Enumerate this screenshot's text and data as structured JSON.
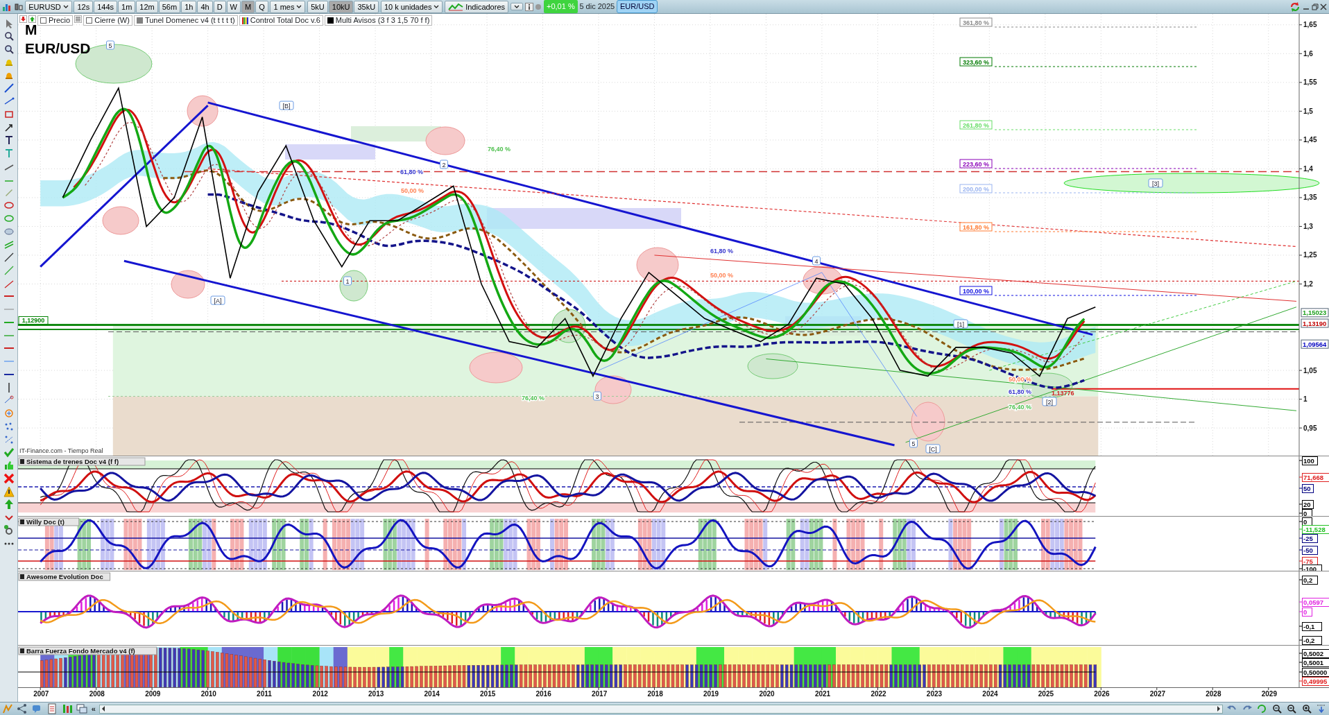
{
  "toolbar": {
    "symbol": "EURUSD",
    "timeframes": [
      {
        "label": "12s",
        "selected": false
      },
      {
        "label": "144s",
        "selected": false
      },
      {
        "label": "1m",
        "selected": false
      },
      {
        "label": "12m",
        "selected": false
      },
      {
        "label": "56m",
        "selected": false
      },
      {
        "label": "1h",
        "selected": false
      },
      {
        "label": "4h",
        "selected": false
      },
      {
        "label": "D",
        "selected": false
      },
      {
        "label": "W",
        "selected": false
      },
      {
        "label": "M",
        "selected": true
      },
      {
        "label": "Q",
        "selected": false
      }
    ],
    "period": "1 mes",
    "units": [
      {
        "label": "5kU",
        "selected": false
      },
      {
        "label": "10kU",
        "selected": true
      },
      {
        "label": "35kU",
        "selected": false
      }
    ],
    "units_dropdown": "10 k unidades",
    "indicators": "Indicadores",
    "change": "+0,01 %",
    "date": "5 dic 2025",
    "instrument": "EUR/USD"
  },
  "legend": [
    {
      "kind": "checkbox",
      "label": "Precio",
      "checked": false
    },
    {
      "kind": "checkbox",
      "label": "Cierre (W)",
      "checked": false
    },
    {
      "kind": "swatch",
      "label": "Tunel Domenec v4 (t t t t t)",
      "color": "#808080"
    },
    {
      "kind": "bars",
      "label": "Control Total Doc v.6"
    },
    {
      "kind": "swatch",
      "label": "Multi Avisos (3 f 3 1,5 70 f f)",
      "color": "#000000"
    }
  ],
  "main_chart": {
    "timeframe_label": "M",
    "source": "IT-Finance.com - Tiempo Real",
    "symbol_label": "EUR/USD",
    "price_axis": [
      "1,65",
      "1,6",
      "1,55",
      "1,5",
      "1,45",
      "1,4",
      "1,35",
      "1,3",
      "1,25",
      "1,2",
      "1,05",
      "1",
      "0,95"
    ],
    "price_tags": [
      {
        "text": "1,15023",
        "color": "#1a9e1a"
      },
      {
        "text": "1,13190",
        "color": "#c00000"
      },
      {
        "text": "1,09564",
        "color": "#0000c0"
      }
    ],
    "line_tag": {
      "text": "1,12900",
      "color": "#008000"
    },
    "fib_labels": [
      {
        "kind": "box",
        "text": "361,80 %",
        "color": "#8a8a8a"
      },
      {
        "kind": "box",
        "text": "323,60 %",
        "color": "#007a00"
      },
      {
        "kind": "box",
        "text": "261,80 %",
        "color": "#66dd66"
      },
      {
        "kind": "box",
        "text": "223,60 %",
        "color": "#8a00b8"
      },
      {
        "kind": "box",
        "text": "200,00 %",
        "color": "#9ab4f0"
      },
      {
        "kind": "box",
        "text": "161,80 %",
        "color": "#ff7a30"
      },
      {
        "kind": "box",
        "text": "100,00 %",
        "color": "#1010e0"
      },
      {
        "kind": "text",
        "text": "76,40 %",
        "color": "#4cbf4c"
      },
      {
        "kind": "text",
        "text": "61,80 %",
        "color": "#3333cc"
      },
      {
        "kind": "text",
        "text": "50,00 %",
        "color": "#ff7f50"
      },
      {
        "kind": "text",
        "text": "61,80 %",
        "color": "#3333cc"
      },
      {
        "kind": "text",
        "text": "50,00 %",
        "color": "#ff7f50"
      },
      {
        "kind": "text",
        "text": "76,40 %",
        "color": "#4cbf4c"
      },
      {
        "kind": "text",
        "text": "50,00 %",
        "color": "#ff7f50"
      },
      {
        "kind": "text",
        "text": "61,80 %",
        "color": "#3333cc"
      },
      {
        "kind": "text",
        "text": "76,40 %",
        "color": "#4cbf4c"
      }
    ],
    "wave_labels": [
      "5",
      "[B]",
      "[A]",
      "1",
      "2",
      "3",
      "4",
      "5",
      "[C]",
      "[1]",
      "[2]",
      "[3]"
    ],
    "price_note": "1,13776"
  },
  "indicators": [
    {
      "kind": "trains",
      "title": "Sistema de trenes Doc v4 (f f)",
      "axis_labels": [
        {
          "text": "100",
          "color": "#000000"
        },
        {
          "text": "71,668",
          "color": "#e02020"
        },
        {
          "text": "50",
          "color": "#000080"
        },
        {
          "text": "20",
          "color": "#000000"
        },
        {
          "text": "0",
          "color": "#000000"
        }
      ]
    },
    {
      "kind": "willy",
      "title": "Willy Doc (t)",
      "axis_labels": [
        {
          "text": "0",
          "color": "#000000"
        },
        {
          "text": "-11,528",
          "color": "#20c020"
        },
        {
          "text": "-25",
          "color": "#000080"
        },
        {
          "text": "-50",
          "color": "#000080"
        },
        {
          "text": "-75",
          "color": "#e02020"
        },
        {
          "text": "-100",
          "color": "#000000"
        }
      ]
    },
    {
      "kind": "awesome",
      "title": "Awesome Evolution Doc",
      "axis_labels": [
        {
          "text": "0,2",
          "color": "#000000"
        },
        {
          "text": "0,0597",
          "color": "#e020e0"
        },
        {
          "text": "0",
          "color": "#e020e0"
        },
        {
          "text": "-0,1",
          "color": "#000000"
        },
        {
          "text": "-0,2",
          "color": "#000000"
        }
      ]
    },
    {
      "kind": "force",
      "title": "Barra Fuerza Fondo Mercado v4 (f)",
      "axis_labels": [
        {
          "text": "0,5002",
          "color": "#000000"
        },
        {
          "text": "0,5001",
          "color": "#000000"
        },
        {
          "text": "0,50000",
          "color": "#000000"
        },
        {
          "text": "0,49995",
          "color": "#e02020"
        }
      ]
    }
  ],
  "time_axis": [
    "2007",
    "2008",
    "2009",
    "2010",
    "2011",
    "2012",
    "2013",
    "2014",
    "2015",
    "2016",
    "2017",
    "2018",
    "2019",
    "2020",
    "2021",
    "2022",
    "2023",
    "2024",
    "2025",
    "2026",
    "2027",
    "2028",
    "2029"
  ],
  "bottom_bar": {
    "collapse": "«"
  }
}
